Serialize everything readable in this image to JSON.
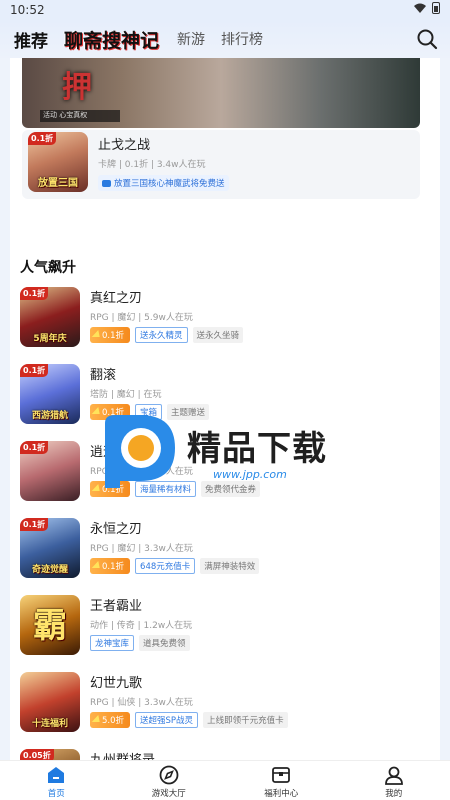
{
  "status": {
    "time": "10:52"
  },
  "nav": {
    "tabs": [
      "推荐",
      "聊斋搜神记",
      "新游",
      "排行榜"
    ]
  },
  "featured": {
    "banner_title": "押",
    "banner_strip": "活动 心宝真权",
    "name": "止戈之战",
    "meta": "卡牌 | 0.1折 | 3.4w人在玩",
    "promo": "放置三国核心神魔武将免费送",
    "icon_caption": "放置三国",
    "icon_badge": "0.1折"
  },
  "section": {
    "title": "人气飙升"
  },
  "games": [
    {
      "name": "真红之刃",
      "meta": "RPG | 魔幻 | 5.9w人在玩",
      "discount": "0.1折",
      "tags_blue": [
        "送永久精灵"
      ],
      "tags_grey": [
        "送永久坐骑"
      ],
      "icon_caption": "5周年庆",
      "icon_badge": "0.1折",
      "colors": [
        "#2a1a1a",
        "#8b1e1e",
        "#e0c28a"
      ]
    },
    {
      "name": "翻滚",
      "meta": "塔防 | 魔幻 | 在玩",
      "discount": "0.1折",
      "tags_blue": [
        "宝箱"
      ],
      "tags_grey": [
        "主题赠送"
      ],
      "icon_caption": "西游猎航",
      "icon_badge": "0.1折",
      "colors": [
        "#1a2a5a",
        "#5b6fd8",
        "#c9d3ff"
      ]
    },
    {
      "name": "逍遥九歌行",
      "meta": "RPG | 仙侠 | 3.8w人在玩",
      "discount": "0.1折",
      "tags_blue": [
        "海量稀有材料"
      ],
      "tags_grey": [
        "免费领代金券"
      ],
      "icon_caption": "",
      "icon_badge": "0.1折",
      "colors": [
        "#3a1f25",
        "#b86a6f",
        "#f1d4c7"
      ]
    },
    {
      "name": "永恒之刃",
      "meta": "RPG | 魔幻 | 3.3w人在玩",
      "discount": "0.1折",
      "tags_blue": [
        "648元充值卡"
      ],
      "tags_grey": [
        "满屏神装特效"
      ],
      "icon_caption": "奇迹觉醒",
      "icon_badge": "0.1折",
      "colors": [
        "#0f1a2e",
        "#3c5f9e",
        "#a9c8f0"
      ]
    },
    {
      "name": "王者霸业",
      "meta": "动作 | 传奇 | 1.2w人在玩",
      "discount": "",
      "tags_blue": [
        "龙神宝库"
      ],
      "tags_grey": [
        "道具免费领"
      ],
      "icon_caption": "霸",
      "icon_badge": "",
      "colors": [
        "#3a1a05",
        "#b5670f",
        "#f7d37a"
      ]
    },
    {
      "name": "幻世九歌",
      "meta": "RPG | 仙侠 | 3.3w人在玩",
      "discount": "5.0折",
      "tags_blue": [
        "送超强SP战灵"
      ],
      "tags_grey": [
        "上线即领千元充值卡"
      ],
      "icon_caption": "十连福利",
      "icon_badge": "",
      "colors": [
        "#3d1212",
        "#c2412d",
        "#f3cf97"
      ]
    },
    {
      "name": "九州群将录",
      "meta": "",
      "discount": "",
      "tags_blue": [],
      "tags_grey": [],
      "icon_caption": "",
      "icon_badge": "0.05折",
      "colors": [
        "#3a2a1a",
        "#8a5a2a",
        "#e0b070"
      ]
    }
  ],
  "watermark": {
    "text": "精品下载",
    "url": "www.jpp.com"
  },
  "bottom_nav": [
    {
      "label": "首页",
      "icon": "home-icon",
      "active": true
    },
    {
      "label": "游戏大厅",
      "icon": "compass-icon",
      "active": false
    },
    {
      "label": "福利中心",
      "icon": "gift-box-icon",
      "active": false
    },
    {
      "label": "我的",
      "icon": "user-icon",
      "active": false
    }
  ],
  "colors": {
    "accent": "#1f7ae0",
    "discount": "#f58a1d",
    "page_bg": "#eef3fb"
  }
}
